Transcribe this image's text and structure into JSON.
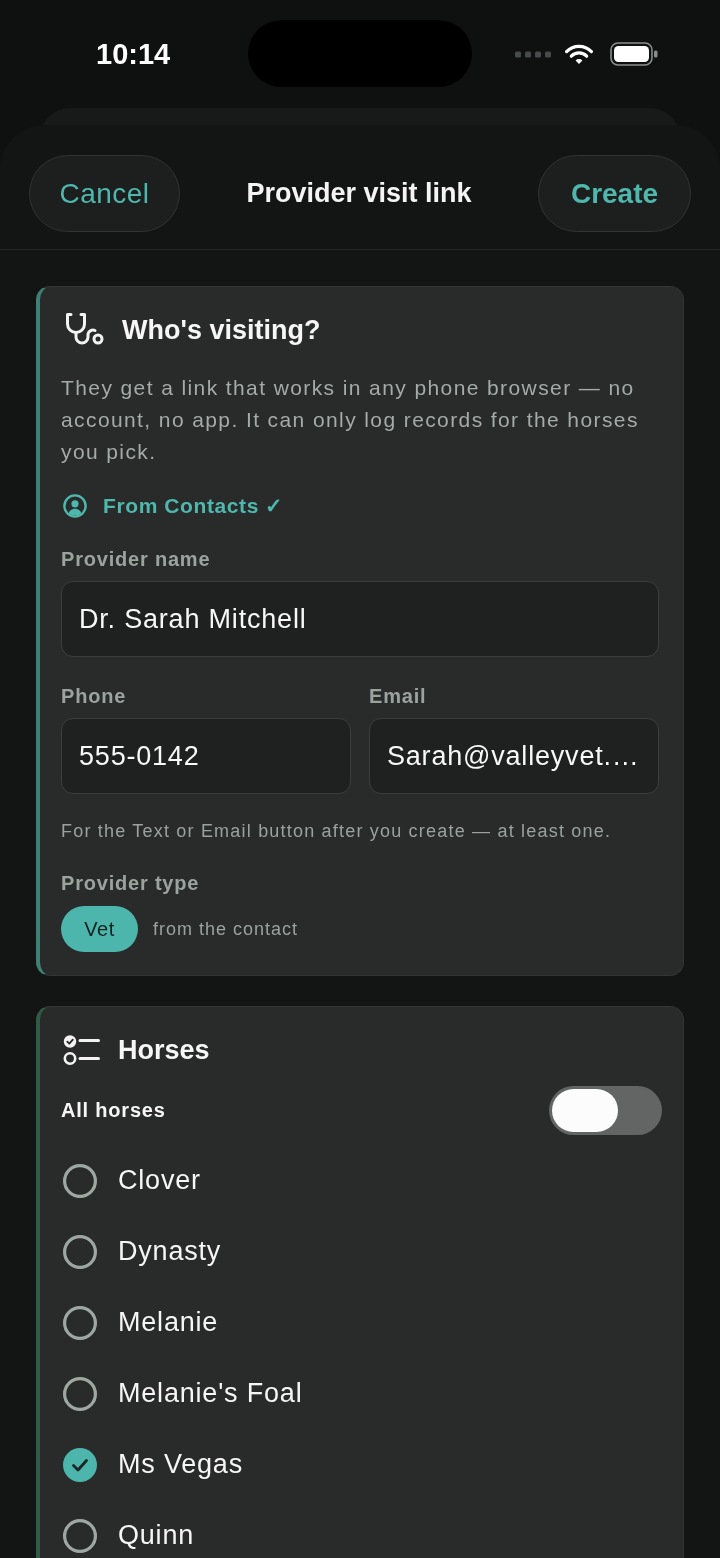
{
  "status_bar": {
    "time": "10:14"
  },
  "header": {
    "cancel_button": "Cancel",
    "title": "Provider visit link",
    "create_button": "Create"
  },
  "visitor_card": {
    "title": "Who's visiting?",
    "description": "They get a link that works in any phone browser — no account, no app. It can only log records for the horses you pick.",
    "contacts_link": "From Contacts ✓",
    "provider_name": {
      "label": "Provider name",
      "value": "Dr. Sarah Mitchell"
    },
    "phone": {
      "label": "Phone",
      "value": "555-0142"
    },
    "email": {
      "label": "Email",
      "value": "Sarah@valleyvet.…"
    },
    "hint": "For the Text or Email button after you create — at least one.",
    "provider_type": {
      "label": "Provider type",
      "chip": "Vet",
      "note": "from the contact"
    }
  },
  "horses_card": {
    "title": "Horses",
    "all_horses": {
      "label": "All horses",
      "on": false
    },
    "horses": [
      {
        "name": "Clover",
        "checked": false
      },
      {
        "name": "Dynasty",
        "checked": false
      },
      {
        "name": "Melanie",
        "checked": false
      },
      {
        "name": "Melanie's Foal",
        "checked": false
      },
      {
        "name": "Ms Vegas",
        "checked": true
      },
      {
        "name": "Quinn",
        "checked": false
      }
    ]
  }
}
